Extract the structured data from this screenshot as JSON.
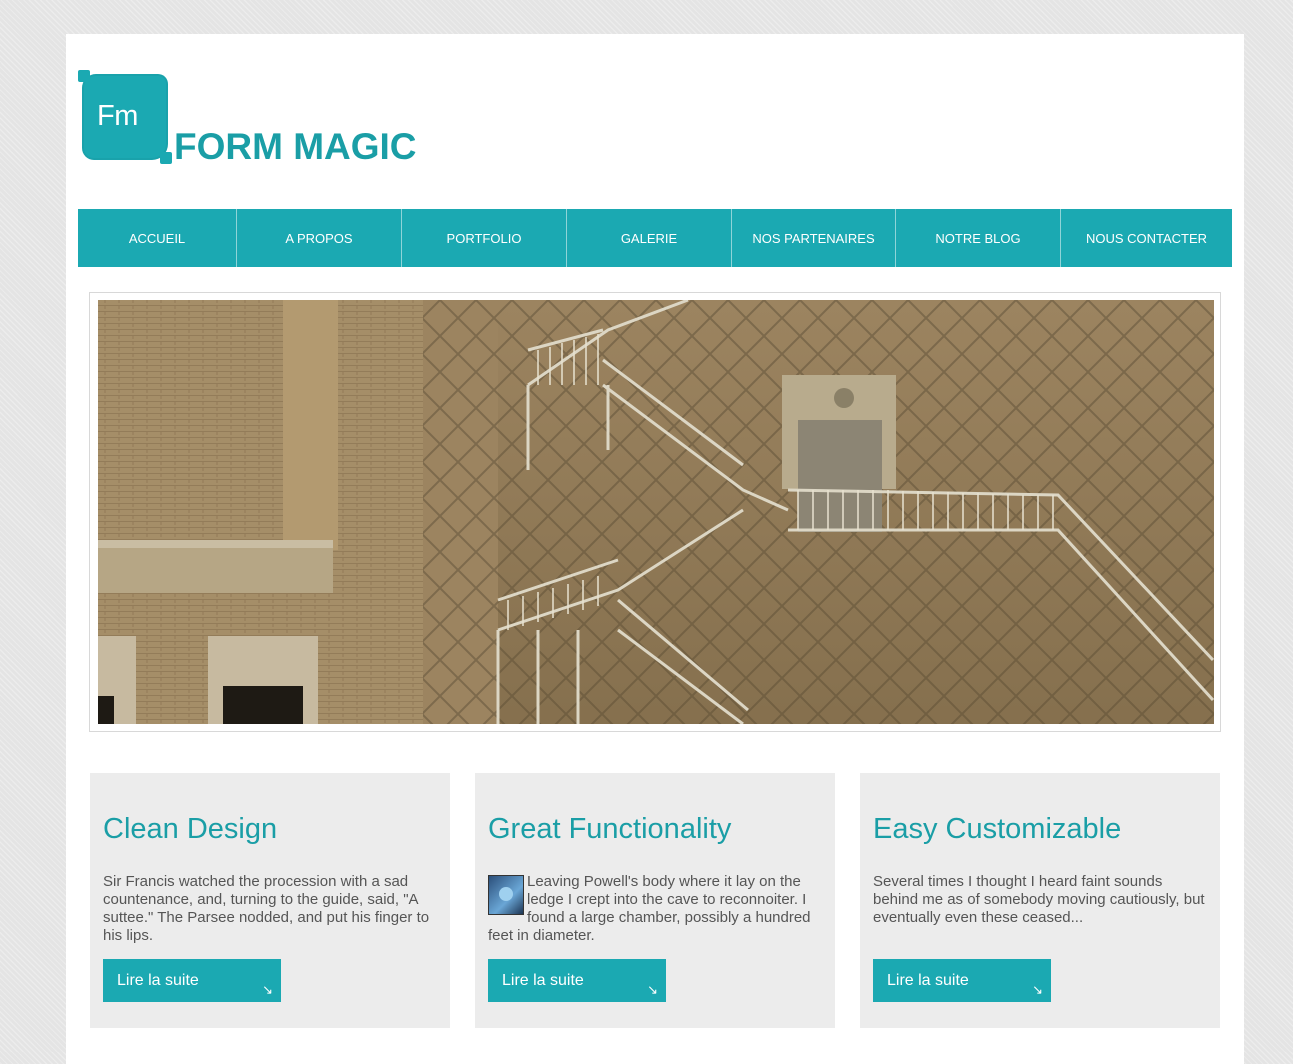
{
  "header": {
    "logo_mark": "Fm",
    "brand": "FORM MAGIC"
  },
  "nav": {
    "items": [
      {
        "label": "ACCUEIL"
      },
      {
        "label": "A PROPOS"
      },
      {
        "label": "PORTFOLIO"
      },
      {
        "label": "GALERIE"
      },
      {
        "label": "NOS PARTENAIRES"
      },
      {
        "label": "NOTRE BLOG"
      },
      {
        "label": "NOUS CONTACTER"
      }
    ]
  },
  "features": [
    {
      "title": "Clean Design",
      "text": "Sir Francis watched the procession with a sad countenance, and, turning to the guide, said, \"A suttee.\" The Parsee nodded, and put his finger to his lips.",
      "button": "Lire la suite"
    },
    {
      "title": "Great Functionality",
      "text": "Leaving Powell's body where it lay on the ledge I crept into the cave to reconnoiter. I found a large chamber, possibly a hundred feet in diameter.",
      "button": "Lire la suite"
    },
    {
      "title": "Easy Customizable",
      "text": "Several times I thought I heard faint sounds behind me as of somebody moving cautiously, but eventually even these ceased...",
      "button": "Lire la suite"
    }
  ],
  "colors": {
    "accent": "#1ba9b2",
    "brand_text": "#1a9ea6",
    "panel": "#ececec"
  },
  "icons": {
    "button_arrow": "arrow-down-right-icon",
    "thumbnail": "document-thumbnail-icon"
  }
}
